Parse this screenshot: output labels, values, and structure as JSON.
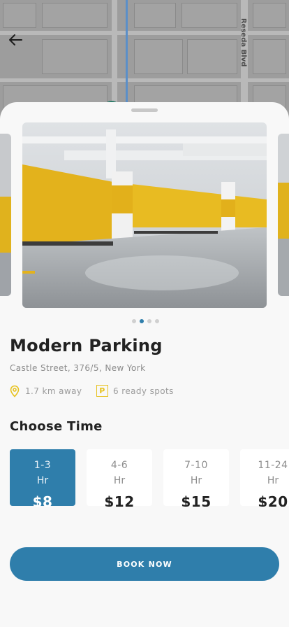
{
  "map": {
    "street_name": "Reseda Blvd"
  },
  "header": {
    "back_icon": "arrow-left-icon"
  },
  "gallery": {
    "image_description_icon": "parking-garage-photo",
    "dot_count": 4,
    "active_index": 1
  },
  "parking": {
    "name": "Modern Parking",
    "address": "Castle Street, 376/5, New York",
    "distance": "1.7 km away",
    "spots": "6 ready spots",
    "distance_icon": "location-pin-icon",
    "spots_icon": "parking-icon",
    "spots_icon_letter": "P"
  },
  "time_section": {
    "title": "Choose Time",
    "options": [
      {
        "range": "1-3",
        "unit": "Hr",
        "price": "$8",
        "selected": true
      },
      {
        "range": "4-6",
        "unit": "Hr",
        "price": "$12",
        "selected": false
      },
      {
        "range": "7-10",
        "unit": "Hr",
        "price": "$15",
        "selected": false
      },
      {
        "range": "11-24",
        "unit": "Hr",
        "price": "$20",
        "selected": false
      }
    ]
  },
  "actions": {
    "book_label": "BOOK NOW"
  },
  "colors": {
    "accent": "#2f7eab",
    "highlight_yellow": "#e7c21f"
  }
}
